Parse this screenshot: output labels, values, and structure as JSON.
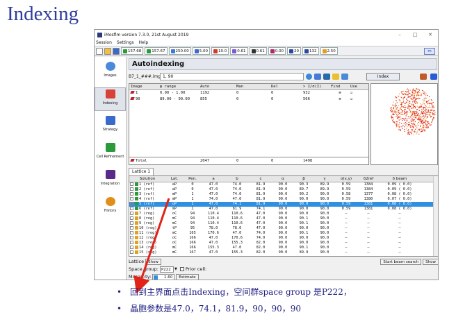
{
  "slide": {
    "title": "Indexing",
    "bullets": [
      "回到主界面点击Indexing，空间群space group 是P222，",
      "晶胞参数是47.0，74.1，81.9，90，90，90"
    ]
  },
  "window": {
    "title": "iMosflm version 7.3.0, 21st August 2019",
    "controls": [
      "–",
      "□",
      "✕"
    ],
    "menu": [
      "Session",
      "Settings",
      "Help"
    ]
  },
  "toolbar": {
    "items": [
      {
        "value": "157.68",
        "color": "#2a9a3a"
      },
      {
        "value": "157.67",
        "color": "#2a9a3a"
      },
      {
        "value": "250.00",
        "color": "#3a7ad8"
      },
      {
        "value": "5.00",
        "color": "#3a6acb"
      },
      {
        "value": "10.0",
        "color": "#d43a2a"
      },
      {
        "value": "0.61",
        "color": "#7a5ad8"
      },
      {
        "value": "0.61",
        "color": "#333333"
      },
      {
        "value": "0.00",
        "color": "#b02a6a"
      },
      {
        "value": "20",
        "color": "#2a4aa0"
      },
      {
        "value": "132",
        "color": "#2a4aa0"
      },
      {
        "value": "2.50",
        "color": "#e0a020"
      }
    ]
  },
  "sidebar": {
    "items": [
      {
        "label": "Images",
        "icon": "images-icon",
        "color": "#4a8ad8",
        "active": false
      },
      {
        "label": "Indexing",
        "icon": "indexing-icon",
        "color": "#d8403a",
        "active": true
      },
      {
        "label": "Strategy",
        "icon": "strategy-icon",
        "color": "#3a6acb",
        "active": false
      },
      {
        "label": "Cell Refinement",
        "icon": "cell-refinement-icon",
        "color": "#2a9a3a",
        "active": false
      },
      {
        "label": "Integration",
        "icon": "integration-icon",
        "color": "#5a2a8a",
        "active": false
      },
      {
        "label": "History",
        "icon": "history-icon",
        "color": "#e0901a",
        "active": false
      }
    ]
  },
  "panel": {
    "title": "Autoindexing",
    "file_label": "B7_1_###.img",
    "file_value": "1, 90",
    "index_button": "Index"
  },
  "image_table": {
    "headers": [
      "Image",
      "φ range",
      "Auto",
      "Man",
      "Del",
      "> I/σ(I)",
      "Find",
      "Use"
    ],
    "rows": [
      {
        "image": "1",
        "phi": "0.00 - 1.00",
        "auto": "1192",
        "man": "0",
        "del": "0",
        "isig": "932"
      },
      {
        "image": "90",
        "phi": "89.00 - 90.00",
        "auto": "855",
        "man": "0",
        "del": "0",
        "isig": "566"
      }
    ],
    "total": {
      "label": "Total",
      "auto": "2047",
      "man": "0",
      "del": "0",
      "isig": "1498"
    }
  },
  "lattice_tab": "Lattice 1",
  "solutions": {
    "headers": [
      "Solution",
      "Lat.",
      "Pen.",
      "a",
      "b",
      "c",
      "α",
      "β",
      "γ",
      "σ(x,y)",
      "δ2ref",
      "δ beam"
    ],
    "rows": [
      [
        "1 (ref)",
        "aP",
        "0",
        "47.0",
        "74.0",
        "81.9",
        "90.0",
        "90.3",
        "89.9",
        "0.59",
        "1384",
        "0.09 ( 0.0)"
      ],
      [
        "2 (ref)",
        "aP",
        "0",
        "47.0",
        "74.0",
        "81.9",
        "90.0",
        "89.7",
        "89.9",
        "0.59",
        "1384",
        "0.09 ( 0.0)"
      ],
      [
        "3 (ref)",
        "mP",
        "1",
        "47.0",
        "74.0",
        "81.9",
        "90.0",
        "90.2",
        "90.0",
        "0.58",
        "1377",
        "0.08 ( 0.0)"
      ],
      [
        "4 (ref)",
        "mP",
        "1",
        "74.0",
        "47.0",
        "81.9",
        "90.0",
        "90.0",
        "90.0",
        "0.59",
        "1380",
        "0.07 ( 0.0)"
      ],
      [
        "5 (ref)",
        "oP",
        "1",
        "47.0",
        "74.1",
        "81.9",
        "90.0",
        "90.0",
        "90.0",
        "0.59",
        "1381",
        "0.08 ( 0.0)"
      ],
      [
        "6 (ref)",
        "mP",
        "1",
        "47.0",
        "81.9",
        "74.1",
        "90.0",
        "90.0",
        "90.0",
        "0.59",
        "1381",
        "0.08 ( 0.0)"
      ],
      [
        "7 (reg)",
        "oC",
        "94",
        "110.4",
        "110.6",
        "47.0",
        "90.0",
        "90.0",
        "90.0",
        "–",
        "–",
        "–"
      ],
      [
        "8 (reg)",
        "mC",
        "94",
        "110.4",
        "110.6",
        "47.0",
        "90.0",
        "90.1",
        "90.0",
        "–",
        "–",
        "–"
      ],
      [
        "9 (reg)",
        "mC",
        "94",
        "110.4",
        "110.6",
        "47.0",
        "90.0",
        "90.1",
        "90.0",
        "–",
        "–",
        "–"
      ],
      [
        "10 (reg)",
        "tP",
        "95",
        "78.0",
        "78.0",
        "47.0",
        "90.0",
        "90.0",
        "90.0",
        "–",
        "–",
        "–"
      ],
      [
        "11 (reg)",
        "mC",
        "165",
        "170.6",
        "47.0",
        "74.0",
        "90.0",
        "90.1",
        "90.0",
        "–",
        "–",
        "–"
      ],
      [
        "12 (reg)",
        "oC",
        "166",
        "47.0",
        "170.6",
        "74.0",
        "90.0",
        "90.0",
        "90.0",
        "–",
        "–",
        "–"
      ],
      [
        "13 (reg)",
        "oC",
        "166",
        "47.0",
        "155.3",
        "82.0",
        "90.0",
        "90.0",
        "90.0",
        "–",
        "–",
        "–"
      ],
      [
        "14 (reg)",
        "mC",
        "166",
        "155.3",
        "47.0",
        "82.0",
        "90.0",
        "90.1",
        "90.0",
        "–",
        "–",
        "–"
      ],
      [
        "15 (reg)",
        "mC",
        "167",
        "47.0",
        "155.3",
        "82.0",
        "90.0",
        "89.9",
        "90.0",
        "–",
        "–",
        "–"
      ]
    ],
    "selected_index": 4,
    "colors": {
      "ref": "#2a9a3a",
      "reg": "#e0a020",
      "selected": "#2f8fe0"
    }
  },
  "bottom": {
    "lattice_label": "Lattice",
    "show_label": "Show",
    "space_group_label": "Space group:",
    "space_group_value": "P222",
    "prior_cell_label": "Prior cell:",
    "mosaicity_label": "Mosaicity:",
    "mosaicity_value": "1.60",
    "estimate_label": "Estimate",
    "start_beam_search": "Start beam search",
    "show_button": "Show"
  }
}
